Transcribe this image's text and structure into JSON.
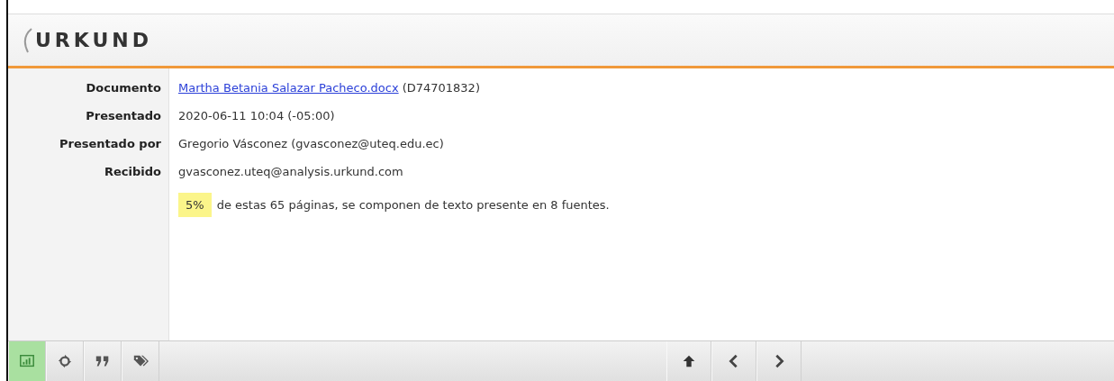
{
  "logo": {
    "text": "URKUND"
  },
  "details": [
    {
      "label": "Documento",
      "link": "Martha Betania Salazar Pacheco.docx",
      "value": "(D74701832)"
    },
    {
      "label": "Presentado",
      "value": "2020-06-11 10:04 (-05:00)"
    },
    {
      "label": "Presentado por",
      "value": "Gregorio Vásconez (gvasconez@uteq.edu.ec)"
    },
    {
      "label": "Recibido",
      "value": "gvasconez.uteq@analysis.urkund.com"
    }
  ],
  "summary": {
    "percent": "5%",
    "text": "de estas 65 páginas, se componen de texto presente en 8 fuentes."
  },
  "toolbar_left": [
    {
      "kind": "chart",
      "selected": true
    },
    {
      "kind": "target",
      "selected": false
    },
    {
      "kind": "quote",
      "selected": false
    },
    {
      "kind": "tags",
      "selected": false
    }
  ],
  "toolbar_right": [
    {
      "kind": "up"
    },
    {
      "kind": "left"
    },
    {
      "kind": "right"
    }
  ]
}
